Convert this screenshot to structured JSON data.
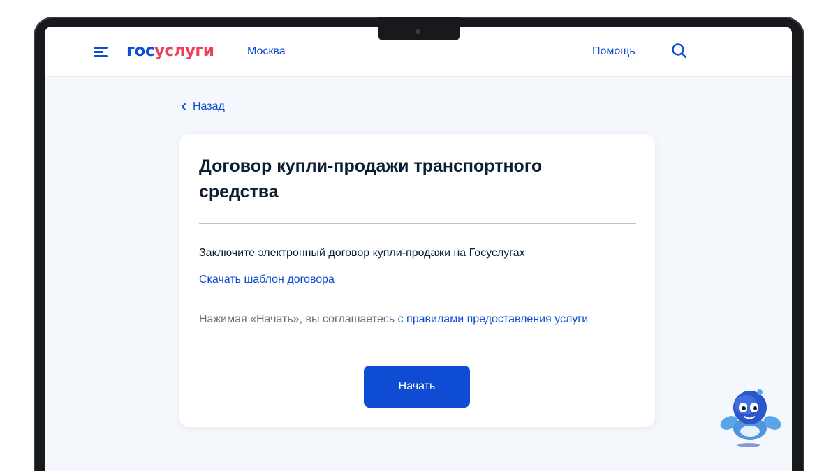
{
  "header": {
    "logo_part1": "гос",
    "logo_part2": "услуги",
    "region": "Москва",
    "help": "Помощь",
    "menu_icon": "hamburger-menu-icon",
    "search_icon": "search-icon"
  },
  "back": {
    "label": "Назад",
    "icon": "chevron-left-icon"
  },
  "card": {
    "title": "Договор купли-продажи транспортного средства",
    "description": "Заключите электронный договор купли-продажи на Госуслугах",
    "download_link": "Скачать шаблон договора",
    "agree_text": "Нажимая «Начать», вы соглашаетесь ",
    "agree_link": "с правилами предоставления услуги",
    "start_button": "Начать"
  },
  "assistant": {
    "icon": "robot-assistant-icon"
  },
  "colors": {
    "brand_blue": "#0d4cd3",
    "brand_red": "#ee3f58",
    "page_bg": "#f4f7fb",
    "text_primary": "#0b1f33",
    "text_secondary": "#66727f"
  }
}
